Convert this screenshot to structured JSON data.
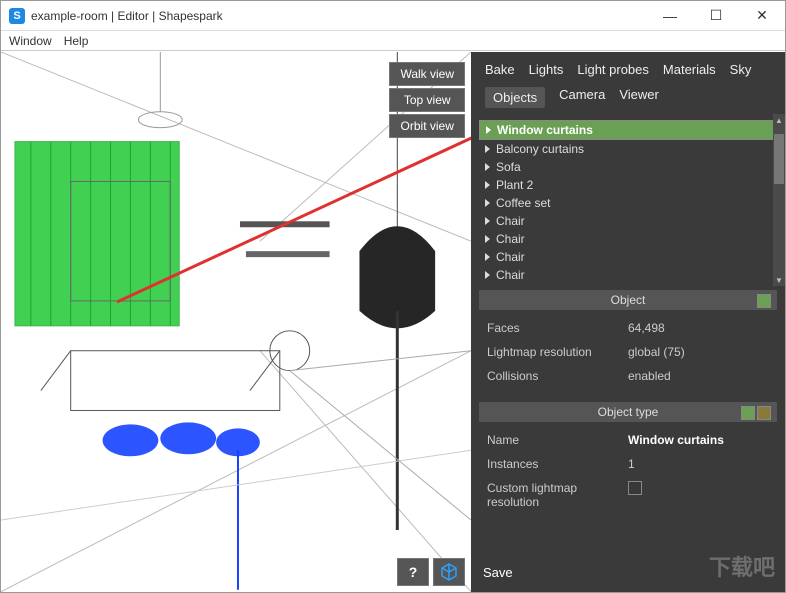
{
  "window": {
    "title": "example-room | Editor | Shapespark",
    "controls": {
      "min": "—",
      "max": "☐",
      "close": "✕"
    }
  },
  "menubar": {
    "items": [
      "Window",
      "Help"
    ]
  },
  "viewport": {
    "view_buttons": [
      "Walk view",
      "Top view",
      "Orbit view"
    ],
    "bottom_buttons": {
      "help": "?",
      "cube": "⬛"
    }
  },
  "sidepanel": {
    "tabs_row1": [
      "Bake",
      "Lights",
      "Light probes",
      "Materials",
      "Sky"
    ],
    "tabs_row2": [
      "Objects",
      "Camera",
      "Viewer"
    ],
    "active_tab": "Objects",
    "tree": [
      {
        "label": "Window curtains",
        "selected": true
      },
      {
        "label": "Balcony curtains"
      },
      {
        "label": "Sofa"
      },
      {
        "label": "Plant 2"
      },
      {
        "label": "Coffee set"
      },
      {
        "label": "Chair"
      },
      {
        "label": "Chair"
      },
      {
        "label": "Chair"
      },
      {
        "label": "Chair"
      }
    ],
    "object_section": {
      "title": "Object",
      "rows": [
        {
          "k": "Faces",
          "v": "64,498"
        },
        {
          "k": "Lightmap resolution",
          "v": "global (75)"
        },
        {
          "k": "Collisions",
          "v": "enabled"
        }
      ]
    },
    "object_type_section": {
      "title": "Object type",
      "rows": [
        {
          "k": "Name",
          "v": "Window curtains",
          "bold": true
        },
        {
          "k": "Instances",
          "v": "1"
        },
        {
          "k": "Custom lightmap resolution",
          "v": ""
        }
      ]
    },
    "save": "Save"
  },
  "watermark": "下载吧"
}
